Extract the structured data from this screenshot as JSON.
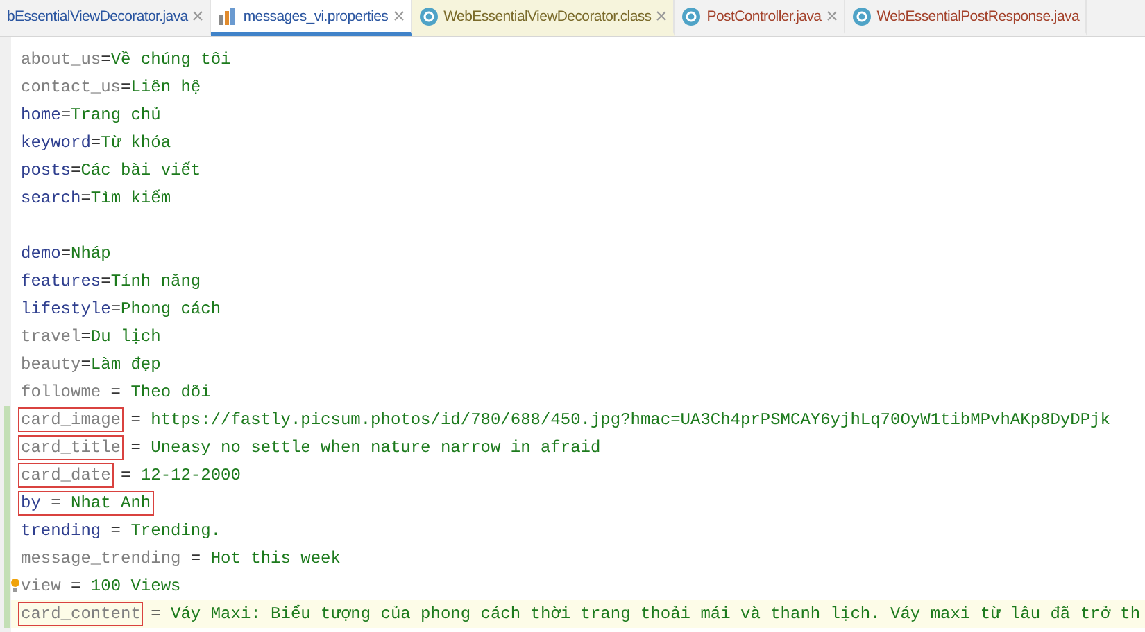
{
  "tabs": [
    {
      "label": "bEssentialViewDecorator.java",
      "kind": "java",
      "selected": false
    },
    {
      "label": "messages_vi.properties",
      "kind": "properties",
      "selected": true
    },
    {
      "label": "WebEssentialViewDecorator.class",
      "kind": "class",
      "selected": false
    },
    {
      "label": "PostController.java",
      "kind": "java-class",
      "selected": false
    },
    {
      "label": "WebEssentialPostResponse.java",
      "kind": "java-class",
      "selected": false
    }
  ],
  "lines": [
    {
      "kind": "entry",
      "key": "about_us",
      "sep": "=",
      "value": "Về chúng tôi",
      "unused": true
    },
    {
      "kind": "entry",
      "key": "contact_us",
      "sep": "=",
      "value": "Liên hệ",
      "unused": true
    },
    {
      "kind": "entry",
      "key": "home",
      "sep": "=",
      "value": "Trang chủ",
      "unused": false
    },
    {
      "kind": "entry",
      "key": "keyword",
      "sep": "=",
      "value": "Từ khóa",
      "unused": false
    },
    {
      "kind": "entry",
      "key": "posts",
      "sep": "=",
      "value": "Các bài viết",
      "unused": false
    },
    {
      "kind": "entry",
      "key": "search",
      "sep": "=",
      "value": "Tìm kiếm",
      "unused": false
    },
    {
      "kind": "blank"
    },
    {
      "kind": "entry",
      "key": "demo",
      "sep": "=",
      "value": "Nháp",
      "unused": false
    },
    {
      "kind": "entry",
      "key": "features",
      "sep": "=",
      "value": "Tính năng",
      "unused": false
    },
    {
      "kind": "entry",
      "key": "lifestyle",
      "sep": "=",
      "value": "Phong cách",
      "unused": false
    },
    {
      "kind": "entry",
      "key": "travel",
      "sep": "=",
      "value": "Du lịch",
      "unused": true
    },
    {
      "kind": "entry",
      "key": "beauty",
      "sep": "=",
      "value": "Làm đẹp",
      "unused": true
    },
    {
      "kind": "entry",
      "key": "followme",
      "sep": " = ",
      "value": "Theo dõi",
      "unused": true
    },
    {
      "kind": "entry",
      "key": "card_image",
      "sep": " = ",
      "value": "https://fastly.picsum.photos/id/780/688/450.jpg?hmac=UA3Ch4prPSMCAY6yjhLq70OyW1tibMPvhAKp8DyDPjk",
      "unused": true,
      "key_boxed": true,
      "modified": true
    },
    {
      "kind": "entry",
      "key": "card_title",
      "sep": " = ",
      "value": "Uneasy no settle when nature narrow in afraid",
      "unused": true,
      "key_boxed": true,
      "modified": true
    },
    {
      "kind": "entry",
      "key": "card_date",
      "sep": " = ",
      "value": "12-12-2000",
      "unused": true,
      "key_boxed": true,
      "modified": true
    },
    {
      "kind": "entry",
      "key": "by",
      "sep": " = ",
      "value": "Nhat Anh",
      "unused": false,
      "line_boxed": true,
      "modified": true
    },
    {
      "kind": "entry",
      "key": "trending",
      "sep": " = ",
      "value": "Trending.",
      "unused": false,
      "modified": true
    },
    {
      "kind": "entry",
      "key": "message_trending",
      "sep": " = ",
      "value": "Hot this week",
      "unused": true,
      "modified": true
    },
    {
      "kind": "entry",
      "key": "view",
      "sep": " = ",
      "value": "100 Views",
      "unused": true,
      "modified": true,
      "hint": true
    },
    {
      "kind": "entry",
      "key": "card_content",
      "sep": " = ",
      "value": "Váy Maxi: Biểu tượng của phong cách thời trang thoải mái và thanh lịch. Váy maxi từ lâu đã trở th",
      "unused": true,
      "key_boxed": true,
      "modified": true,
      "current": true
    }
  ]
}
